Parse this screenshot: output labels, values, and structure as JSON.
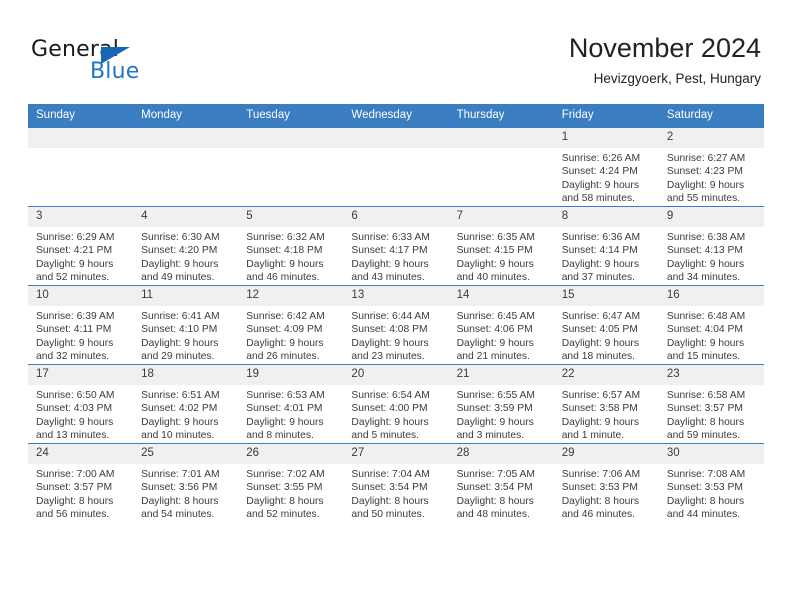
{
  "brand": {
    "name_part1": "General",
    "name_part2": "Blue",
    "accent_color": "#1668b3"
  },
  "header": {
    "title": "November 2024",
    "subtitle": "Hevizgyoerk, Pest, Hungary"
  },
  "calendar": {
    "header_color": "#3a7dc0",
    "daynum_band_color": "#f0f0f0",
    "weekday_headers": [
      "Sunday",
      "Monday",
      "Tuesday",
      "Wednesday",
      "Thursday",
      "Friday",
      "Saturday"
    ],
    "weeks": [
      [
        {
          "day": "",
          "sunrise": "",
          "sunset": "",
          "daylight_line1": "",
          "daylight_line2": ""
        },
        {
          "day": "",
          "sunrise": "",
          "sunset": "",
          "daylight_line1": "",
          "daylight_line2": ""
        },
        {
          "day": "",
          "sunrise": "",
          "sunset": "",
          "daylight_line1": "",
          "daylight_line2": ""
        },
        {
          "day": "",
          "sunrise": "",
          "sunset": "",
          "daylight_line1": "",
          "daylight_line2": ""
        },
        {
          "day": "",
          "sunrise": "",
          "sunset": "",
          "daylight_line1": "",
          "daylight_line2": ""
        },
        {
          "day": "1",
          "sunrise": "Sunrise: 6:26 AM",
          "sunset": "Sunset: 4:24 PM",
          "daylight_line1": "Daylight: 9 hours",
          "daylight_line2": "and 58 minutes."
        },
        {
          "day": "2",
          "sunrise": "Sunrise: 6:27 AM",
          "sunset": "Sunset: 4:23 PM",
          "daylight_line1": "Daylight: 9 hours",
          "daylight_line2": "and 55 minutes."
        }
      ],
      [
        {
          "day": "3",
          "sunrise": "Sunrise: 6:29 AM",
          "sunset": "Sunset: 4:21 PM",
          "daylight_line1": "Daylight: 9 hours",
          "daylight_line2": "and 52 minutes."
        },
        {
          "day": "4",
          "sunrise": "Sunrise: 6:30 AM",
          "sunset": "Sunset: 4:20 PM",
          "daylight_line1": "Daylight: 9 hours",
          "daylight_line2": "and 49 minutes."
        },
        {
          "day": "5",
          "sunrise": "Sunrise: 6:32 AM",
          "sunset": "Sunset: 4:18 PM",
          "daylight_line1": "Daylight: 9 hours",
          "daylight_line2": "and 46 minutes."
        },
        {
          "day": "6",
          "sunrise": "Sunrise: 6:33 AM",
          "sunset": "Sunset: 4:17 PM",
          "daylight_line1": "Daylight: 9 hours",
          "daylight_line2": "and 43 minutes."
        },
        {
          "day": "7",
          "sunrise": "Sunrise: 6:35 AM",
          "sunset": "Sunset: 4:15 PM",
          "daylight_line1": "Daylight: 9 hours",
          "daylight_line2": "and 40 minutes."
        },
        {
          "day": "8",
          "sunrise": "Sunrise: 6:36 AM",
          "sunset": "Sunset: 4:14 PM",
          "daylight_line1": "Daylight: 9 hours",
          "daylight_line2": "and 37 minutes."
        },
        {
          "day": "9",
          "sunrise": "Sunrise: 6:38 AM",
          "sunset": "Sunset: 4:13 PM",
          "daylight_line1": "Daylight: 9 hours",
          "daylight_line2": "and 34 minutes."
        }
      ],
      [
        {
          "day": "10",
          "sunrise": "Sunrise: 6:39 AM",
          "sunset": "Sunset: 4:11 PM",
          "daylight_line1": "Daylight: 9 hours",
          "daylight_line2": "and 32 minutes."
        },
        {
          "day": "11",
          "sunrise": "Sunrise: 6:41 AM",
          "sunset": "Sunset: 4:10 PM",
          "daylight_line1": "Daylight: 9 hours",
          "daylight_line2": "and 29 minutes."
        },
        {
          "day": "12",
          "sunrise": "Sunrise: 6:42 AM",
          "sunset": "Sunset: 4:09 PM",
          "daylight_line1": "Daylight: 9 hours",
          "daylight_line2": "and 26 minutes."
        },
        {
          "day": "13",
          "sunrise": "Sunrise: 6:44 AM",
          "sunset": "Sunset: 4:08 PM",
          "daylight_line1": "Daylight: 9 hours",
          "daylight_line2": "and 23 minutes."
        },
        {
          "day": "14",
          "sunrise": "Sunrise: 6:45 AM",
          "sunset": "Sunset: 4:06 PM",
          "daylight_line1": "Daylight: 9 hours",
          "daylight_line2": "and 21 minutes."
        },
        {
          "day": "15",
          "sunrise": "Sunrise: 6:47 AM",
          "sunset": "Sunset: 4:05 PM",
          "daylight_line1": "Daylight: 9 hours",
          "daylight_line2": "and 18 minutes."
        },
        {
          "day": "16",
          "sunrise": "Sunrise: 6:48 AM",
          "sunset": "Sunset: 4:04 PM",
          "daylight_line1": "Daylight: 9 hours",
          "daylight_line2": "and 15 minutes."
        }
      ],
      [
        {
          "day": "17",
          "sunrise": "Sunrise: 6:50 AM",
          "sunset": "Sunset: 4:03 PM",
          "daylight_line1": "Daylight: 9 hours",
          "daylight_line2": "and 13 minutes."
        },
        {
          "day": "18",
          "sunrise": "Sunrise: 6:51 AM",
          "sunset": "Sunset: 4:02 PM",
          "daylight_line1": "Daylight: 9 hours",
          "daylight_line2": "and 10 minutes."
        },
        {
          "day": "19",
          "sunrise": "Sunrise: 6:53 AM",
          "sunset": "Sunset: 4:01 PM",
          "daylight_line1": "Daylight: 9 hours",
          "daylight_line2": "and 8 minutes."
        },
        {
          "day": "20",
          "sunrise": "Sunrise: 6:54 AM",
          "sunset": "Sunset: 4:00 PM",
          "daylight_line1": "Daylight: 9 hours",
          "daylight_line2": "and 5 minutes."
        },
        {
          "day": "21",
          "sunrise": "Sunrise: 6:55 AM",
          "sunset": "Sunset: 3:59 PM",
          "daylight_line1": "Daylight: 9 hours",
          "daylight_line2": "and 3 minutes."
        },
        {
          "day": "22",
          "sunrise": "Sunrise: 6:57 AM",
          "sunset": "Sunset: 3:58 PM",
          "daylight_line1": "Daylight: 9 hours",
          "daylight_line2": "and 1 minute."
        },
        {
          "day": "23",
          "sunrise": "Sunrise: 6:58 AM",
          "sunset": "Sunset: 3:57 PM",
          "daylight_line1": "Daylight: 8 hours",
          "daylight_line2": "and 59 minutes."
        }
      ],
      [
        {
          "day": "24",
          "sunrise": "Sunrise: 7:00 AM",
          "sunset": "Sunset: 3:57 PM",
          "daylight_line1": "Daylight: 8 hours",
          "daylight_line2": "and 56 minutes."
        },
        {
          "day": "25",
          "sunrise": "Sunrise: 7:01 AM",
          "sunset": "Sunset: 3:56 PM",
          "daylight_line1": "Daylight: 8 hours",
          "daylight_line2": "and 54 minutes."
        },
        {
          "day": "26",
          "sunrise": "Sunrise: 7:02 AM",
          "sunset": "Sunset: 3:55 PM",
          "daylight_line1": "Daylight: 8 hours",
          "daylight_line2": "and 52 minutes."
        },
        {
          "day": "27",
          "sunrise": "Sunrise: 7:04 AM",
          "sunset": "Sunset: 3:54 PM",
          "daylight_line1": "Daylight: 8 hours",
          "daylight_line2": "and 50 minutes."
        },
        {
          "day": "28",
          "sunrise": "Sunrise: 7:05 AM",
          "sunset": "Sunset: 3:54 PM",
          "daylight_line1": "Daylight: 8 hours",
          "daylight_line2": "and 48 minutes."
        },
        {
          "day": "29",
          "sunrise": "Sunrise: 7:06 AM",
          "sunset": "Sunset: 3:53 PM",
          "daylight_line1": "Daylight: 8 hours",
          "daylight_line2": "and 46 minutes."
        },
        {
          "day": "30",
          "sunrise": "Sunrise: 7:08 AM",
          "sunset": "Sunset: 3:53 PM",
          "daylight_line1": "Daylight: 8 hours",
          "daylight_line2": "and 44 minutes."
        }
      ]
    ]
  }
}
